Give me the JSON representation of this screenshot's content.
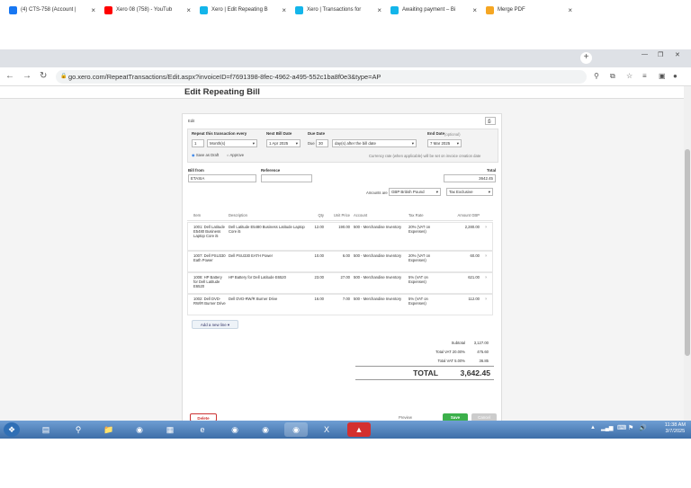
{
  "browser": {
    "tabs": [
      {
        "label": "(4) CTS-758 (Account |",
        "color": "#1877f2"
      },
      {
        "label": "Xero 08 (758) - YouTub",
        "color": "#ff0000"
      },
      {
        "label": "Xero | Edit Repeating B",
        "color": "#13b5ea"
      },
      {
        "label": "Xero | Transactions for",
        "color": "#13b5ea"
      },
      {
        "label": "Awaiting payment – Bi",
        "color": "#13b5ea"
      },
      {
        "label": "Merge PDF",
        "color": "#f5a623"
      }
    ],
    "url": "go.xero.com/RepeatTransactions/Edit.aspx?invoiceID=f7691398-8fec-4962-a495-552c1ba8f0e3&type=AP"
  },
  "page": {
    "title": "Edit Repeating Bill"
  },
  "form": {
    "edit_label": "Edit",
    "repeat_label": "Repeat this transaction every",
    "repeat_value": "1",
    "repeat_unit": "Month(s)",
    "next_bill_label": "Next Bill Date",
    "next_bill_value": "1 Apr 2025",
    "due_label": "Due Date",
    "due_prefix": "Due",
    "due_value": "30",
    "due_rule": "day(s) after the bill date",
    "end_label": "End Date",
    "end_optional": "(optional)",
    "end_value": "7 Mar 2025",
    "save_draft": "Save as Draft",
    "approve": "Approve",
    "currency_note": "Currency rate (when applicable) will be set on invoice creation date",
    "bill_from_label": "Bill from",
    "bill_from_value": "ETASIA",
    "reference_label": "Reference",
    "total_label": "Total",
    "total_value": "3642.45",
    "amounts_label": "Amounts are",
    "amounts_value": "GBP British Pound",
    "tax_label": "Tax Exclusive"
  },
  "table": {
    "headers": [
      "Item",
      "Description",
      "Qty",
      "Unit Price",
      "Account",
      "Tax Rate",
      "Amount GBP"
    ],
    "rows": [
      {
        "item": "1001: Dell Latitude E5480 Business Laptop Core i5",
        "desc": "Dell Latitude E5480 Business Latitude Laptop Core i5",
        "qty": "12.00",
        "price": "190.00",
        "account": "500 - Merchandise Inventory",
        "tax": "20% (VAT on Expenses)",
        "amount": "2,280.00"
      },
      {
        "item": "1007: Dell PSU330 Eath Power",
        "desc": "Dell PSU330 EATH Power",
        "qty": "10.00",
        "price": "6.00",
        "account": "500 - Merchandise Inventory",
        "tax": "20% (VAT on Expenses)",
        "amount": "60.00"
      },
      {
        "item": "1008: HP Battery for Dell Latitude E6520",
        "desc": "HP Battery for Dell Latitude E6520",
        "qty": "23.00",
        "price": "27.00",
        "account": "500 - Merchandise Inventory",
        "tax": "5% (VAT on Expenses)",
        "amount": "621.00"
      },
      {
        "item": "1002: Dell DVD-RW/R Burner Drive",
        "desc": "Dell DVD-RW/R Burner Drive",
        "qty": "16.00",
        "price": "7.00",
        "account": "500 - Merchandise Inventory",
        "tax": "5% (VAT on Expenses)",
        "amount": "112.00"
      }
    ],
    "add_line": "Add a new line"
  },
  "totals": {
    "subtotal_label": "Subtotal",
    "subtotal": "3,127.00",
    "vat20_label": "Total VAT 20.00%",
    "vat20": "475.60",
    "vat5_label": "Total VAT 5.00%",
    "vat5": "36.85",
    "total_label": "TOTAL",
    "total": "3,642.45"
  },
  "actions": {
    "delete": "Delete",
    "preview": "Preview",
    "save": "Save",
    "cancel": "Cancel"
  },
  "taskbar": {
    "time": "11:38 AM",
    "date": "3/7/2025"
  }
}
